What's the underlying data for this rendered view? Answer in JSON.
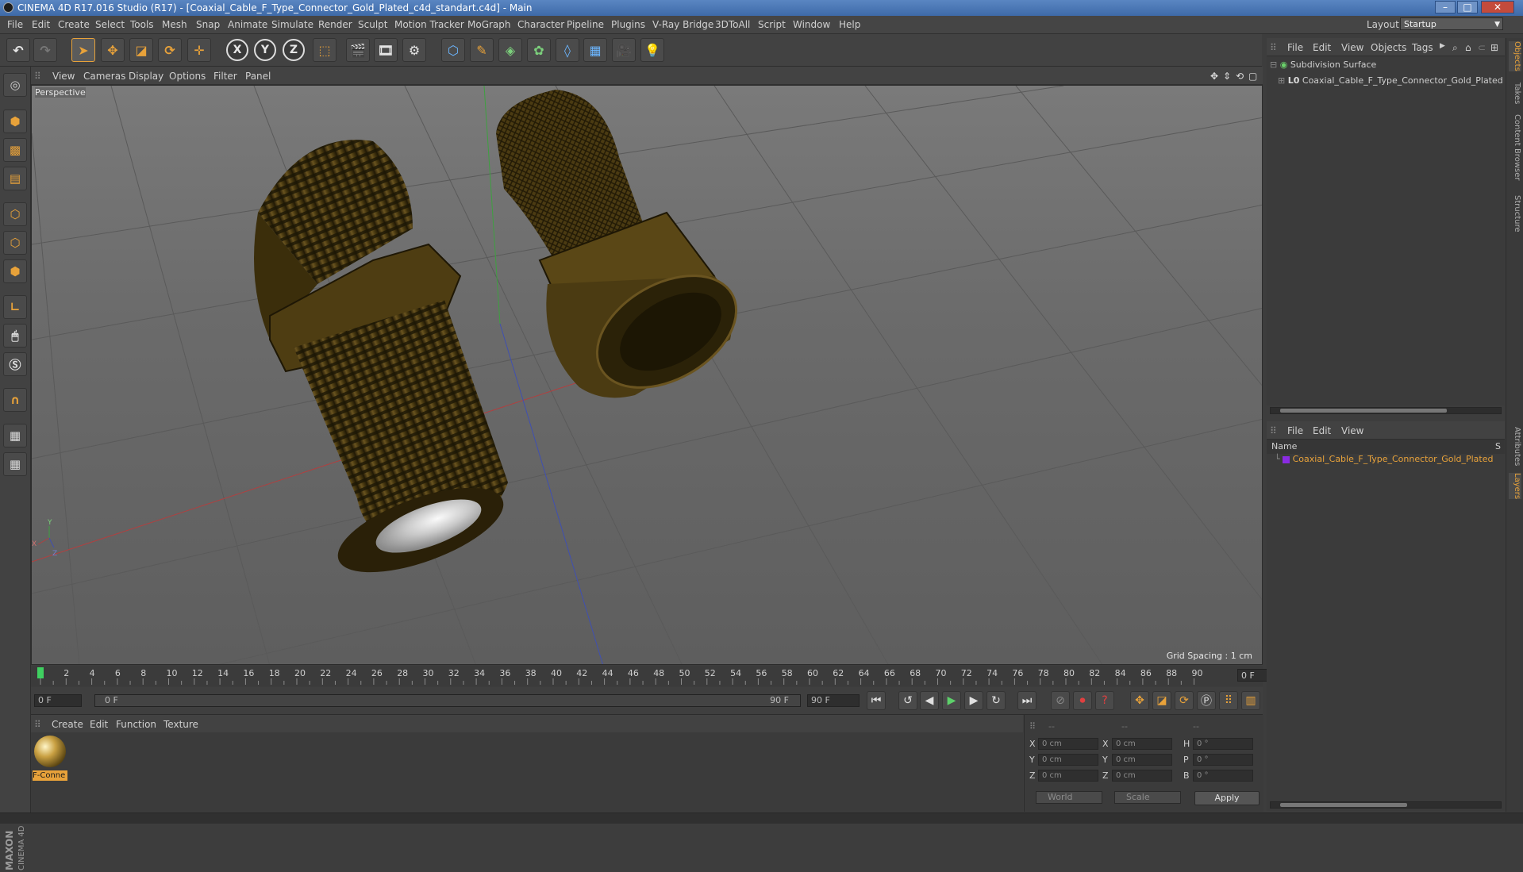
{
  "window": {
    "title": "CINEMA 4D R17.016 Studio (R17) - [Coaxial_Cable_F_Type_Connector_Gold_Plated_c4d_standart.c4d] - Main",
    "controls": {
      "minimize": "–",
      "maximize": "□",
      "close": "✕"
    }
  },
  "menu": {
    "items": [
      "File",
      "Edit",
      "Create",
      "Select",
      "Tools",
      "Mesh",
      "Snap",
      "Animate",
      "Simulate",
      "Render",
      "Sculpt",
      "Motion Tracker",
      "MoGraph",
      "Character",
      "Pipeline",
      "Plugins",
      "V-Ray Bridge",
      "3DToAll",
      "Script",
      "Window",
      "Help"
    ],
    "layout_label": "Layout:",
    "layout_value": "Startup"
  },
  "toolbar": {
    "axis_x": "X",
    "axis_y": "Y",
    "axis_z": "Z"
  },
  "viewport": {
    "menu": [
      "View",
      "Cameras",
      "Display",
      "Options",
      "Filter",
      "Panel"
    ],
    "label": "Perspective",
    "grid_spacing": "Grid Spacing : 1 cm",
    "axis_y": "Y",
    "axis_x": "X",
    "axis_z": "Z"
  },
  "timeline": {
    "ticks": [
      "0",
      "2",
      "4",
      "6",
      "8",
      "10",
      "12",
      "14",
      "16",
      "18",
      "20",
      "22",
      "24",
      "26",
      "28",
      "30",
      "32",
      "34",
      "36",
      "38",
      "40",
      "42",
      "44",
      "46",
      "48",
      "50",
      "52",
      "54",
      "56",
      "58",
      "60",
      "62",
      "64",
      "66",
      "68",
      "70",
      "72",
      "74",
      "76",
      "78",
      "80",
      "82",
      "84",
      "86",
      "88",
      "90"
    ],
    "current_frame": "0 F",
    "start_field": "0 F",
    "range_start": "0 F",
    "range_end": "90 F",
    "end_field": "90 F"
  },
  "materials": {
    "menu": [
      "Create",
      "Edit",
      "Function",
      "Texture"
    ],
    "items": [
      {
        "name": "F-Conne"
      }
    ]
  },
  "coordinates": {
    "header": [
      "--",
      "--",
      "--"
    ],
    "rows": [
      {
        "a": "X",
        "av": "0 cm",
        "b": "X",
        "bv": "0 cm",
        "c": "H",
        "cv": "0 °"
      },
      {
        "a": "Y",
        "av": "0 cm",
        "b": "Y",
        "bv": "0 cm",
        "c": "P",
        "cv": "0 °"
      },
      {
        "a": "Z",
        "av": "0 cm",
        "b": "Z",
        "bv": "0 cm",
        "c": "B",
        "cv": "0 °"
      }
    ],
    "mode": "World",
    "transform": "Scale",
    "apply": "Apply"
  },
  "objects": {
    "menu": [
      "File",
      "Edit",
      "View",
      "Objects",
      "Tags"
    ],
    "tree": [
      {
        "name": "Subdivision Surface"
      },
      {
        "name": "Coaxial_Cable_F_Type_Connector_Gold_Plated"
      }
    ]
  },
  "layers": {
    "menu": [
      "File",
      "Edit",
      "View"
    ],
    "column_name": "Name",
    "column_s": "S",
    "rows": [
      {
        "name": "Coaxial_Cable_F_Type_Connector_Gold_Plated"
      }
    ]
  },
  "side_tabs": [
    "Objects",
    "Takes",
    "Content Browser",
    "Structure",
    "Attributes",
    "Layers"
  ],
  "brand": {
    "maxon": "MAXON",
    "product": "CINEMA 4D"
  },
  "colors": {
    "accent": "#e8a23a",
    "layer_color": "#8a2be2"
  }
}
